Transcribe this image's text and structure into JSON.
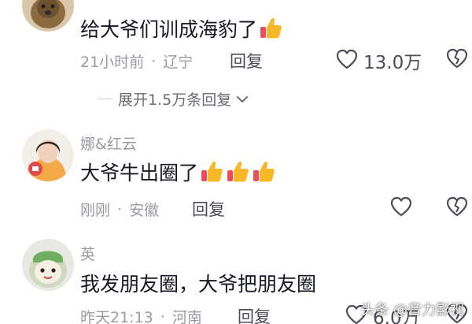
{
  "comments": [
    {
      "username": "",
      "text": "给大爷们训成海豹了",
      "thumbs": 1,
      "time": "21小时前",
      "separator": "·",
      "location": "辽宁",
      "reply_label": "回复",
      "likes": "13.0万",
      "icons": {
        "like": "heart-outline-icon",
        "dislike": "broken-heart-icon",
        "emoji": "thumbs-up-emoji"
      }
    },
    {
      "username": "娜&红云",
      "text": "大爷牛出圈了",
      "thumbs": 3,
      "time": "刚刚",
      "separator": "·",
      "location": "安徽",
      "reply_label": "回复",
      "likes": "",
      "icons": {
        "like": "heart-outline-icon",
        "dislike": "broken-heart-icon",
        "emoji": "thumbs-up-emoji"
      }
    },
    {
      "username": "英",
      "text": "我发朋友圈，大爷把朋友圈",
      "thumbs": 0,
      "time": "昨天21:13",
      "separator": "·",
      "location": "河南",
      "reply_label": "回复",
      "likes": "6.0万",
      "icons": {
        "like": "heart-outline-icon",
        "dislike": "broken-heart-icon"
      }
    }
  ],
  "expand_replies": {
    "label": "展开1.5万条回复",
    "icon": "chevron-down-icon"
  },
  "watermark": "头条 @音力影视",
  "colors": {
    "text": "#161823",
    "meta": "#9a9ba1",
    "action": "#4b4c55",
    "emoji_yellow": "#f7b829",
    "emoji_red": "#ef4b5c"
  }
}
